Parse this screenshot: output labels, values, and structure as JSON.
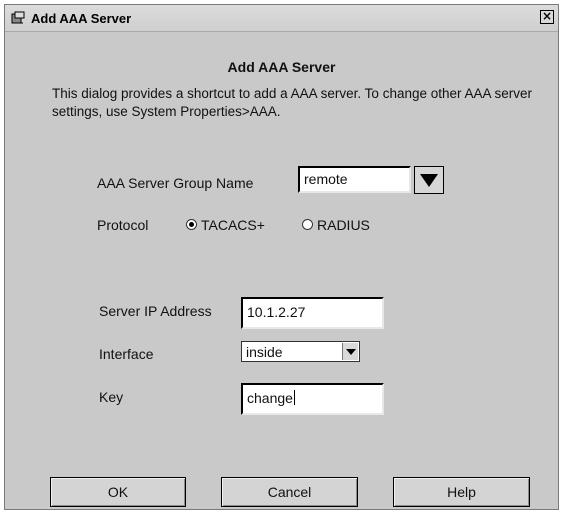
{
  "window": {
    "title": "Add AAA Server",
    "close_glyph": "×"
  },
  "dialog": {
    "heading": "Add AAA Server",
    "description": "This dialog provides a shortcut to add a AAA server. To change other AAA server settings, use System Properties>AAA."
  },
  "form": {
    "group_name_label": "AAA Server Group Name",
    "group_name_value": "remote",
    "protocol_label": "Protocol",
    "protocol_options": [
      {
        "label": "TACACS+",
        "selected": true
      },
      {
        "label": "RADIUS",
        "selected": false
      }
    ],
    "server_ip_label": "Server IP Address",
    "server_ip_value": "10.1.2.27",
    "interface_label": "Interface",
    "interface_value": "inside",
    "key_label": "Key",
    "key_value": "change"
  },
  "buttons": {
    "ok": "OK",
    "cancel": "Cancel",
    "help": "Help"
  },
  "icons": {
    "app": "server-wizard-icon",
    "close": "close-icon",
    "dropdown": "chevron-down-icon"
  }
}
